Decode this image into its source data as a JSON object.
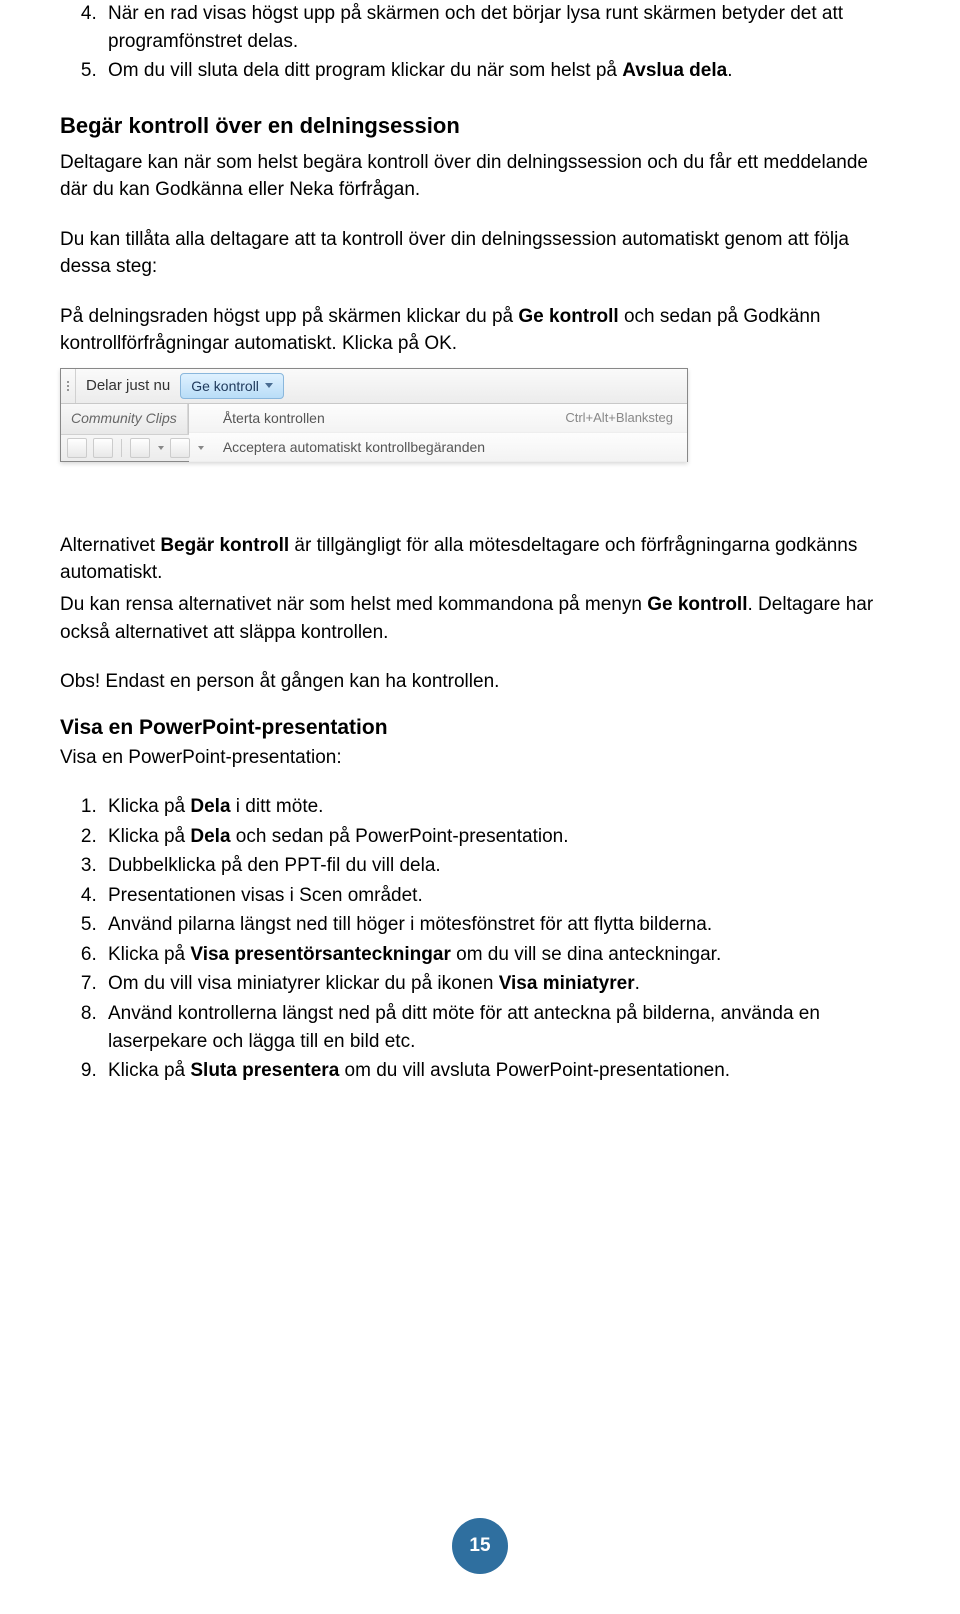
{
  "list_a": {
    "start": 4,
    "items": [
      {
        "pre": "När en rad visas högst upp på skärmen och det börjar lysa runt skärmen betyder det att programfönstret delas."
      },
      {
        "pre": "Om du vill sluta dela ditt program klickar du när som helst på ",
        "bold": "Avslua dela",
        "post": "."
      }
    ]
  },
  "heading1": "Begär kontroll över en delningsession",
  "para1": "Deltagare kan när som helst begära kontroll över din delningssession och du får ett meddelande där du kan Godkänna eller Neka förfrågan.",
  "para2": "Du kan tillåta alla deltagare att ta kontroll över din delningssession automatiskt genom att följa dessa steg:",
  "para3_pre": "På delningsraden högst upp på skärmen klickar du på ",
  "para3_b": "Ge kontroll",
  "para3_post": " och sedan på Godkänn kontrollförfrågningar automatiskt. Klicka på OK.",
  "shot": {
    "sharing": "Delar just nu",
    "btn": "Ge kontroll",
    "tab": "Community Clips",
    "menu1": "Återta kontrollen",
    "menu1_short": "Ctrl+Alt+Blanksteg",
    "menu2": "Acceptera automatiskt kontrollbegäranden"
  },
  "para4_pre": "Alternativet ",
  "para4_b1": "Begär kontroll",
  "para4_mid": " är tillgängligt för alla mötesdeltagare och förfrågningarna godkänns automatiskt.",
  "para5_pre": "Du kan rensa alternativet när som helst med kommandona på menyn ",
  "para5_b": "Ge kontroll",
  "para5_post": ". Deltagare har också alternativet att släppa kontrollen.",
  "para6": "Obs! Endast en person åt gången kan ha kontrollen.",
  "heading2": "Visa en PowerPoint-presentation",
  "para7": "Visa en PowerPoint-presentation:",
  "list_b": [
    {
      "pre": "Klicka på ",
      "b": "Dela",
      "post": " i ditt möte."
    },
    {
      "pre": "Klicka på ",
      "b": "Dela",
      "post": " och sedan på PowerPoint-presentation."
    },
    {
      "pre": "Dubbelklicka på den PPT-fil du vill dela."
    },
    {
      "pre": "Presentationen visas i Scen området."
    },
    {
      "pre": "Använd pilarna längst ned till höger i mötesfönstret för att flytta bilderna."
    },
    {
      "pre": "Klicka på ",
      "b": "Visa presentörsanteckningar",
      "post": " om du vill se dina anteckningar."
    },
    {
      "pre": "Om du vill visa miniatyrer klickar du på ikonen ",
      "b": "Visa miniatyrer",
      "post": "."
    },
    {
      "pre": "Använd kontrollerna längst ned på ditt möte för att anteckna på bilderna, använda en laserpekare och lägga till en bild etc."
    },
    {
      "pre": "Klicka på ",
      "b": "Sluta presentera",
      "post": " om du vill avsluta PowerPoint-presentationen."
    }
  ],
  "page_number": "15"
}
